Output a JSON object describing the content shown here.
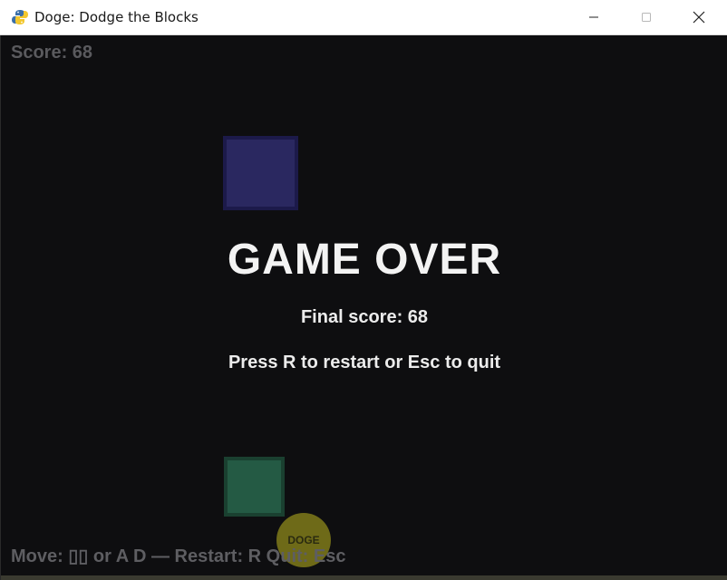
{
  "window": {
    "title": "Doge: Dodge the Blocks",
    "icon": "python-snake-icon",
    "controls": [
      "minimize-icon",
      "maximize-icon",
      "close-icon"
    ]
  },
  "hud": {
    "score_text": "Score: 68",
    "controls_text": "Move: ▯▯ or A D  —  Restart: R  Quit: Esc"
  },
  "overlay": {
    "title": "GAME OVER",
    "final_score": "Final score: 68",
    "hint": "Press R to restart or Esc to quit"
  },
  "player": {
    "label": "DOGE",
    "color": "#6e6a18"
  },
  "colors": {
    "background": "#0e0e10",
    "block_blue": "#2a2860",
    "block_green": "#245a44"
  }
}
